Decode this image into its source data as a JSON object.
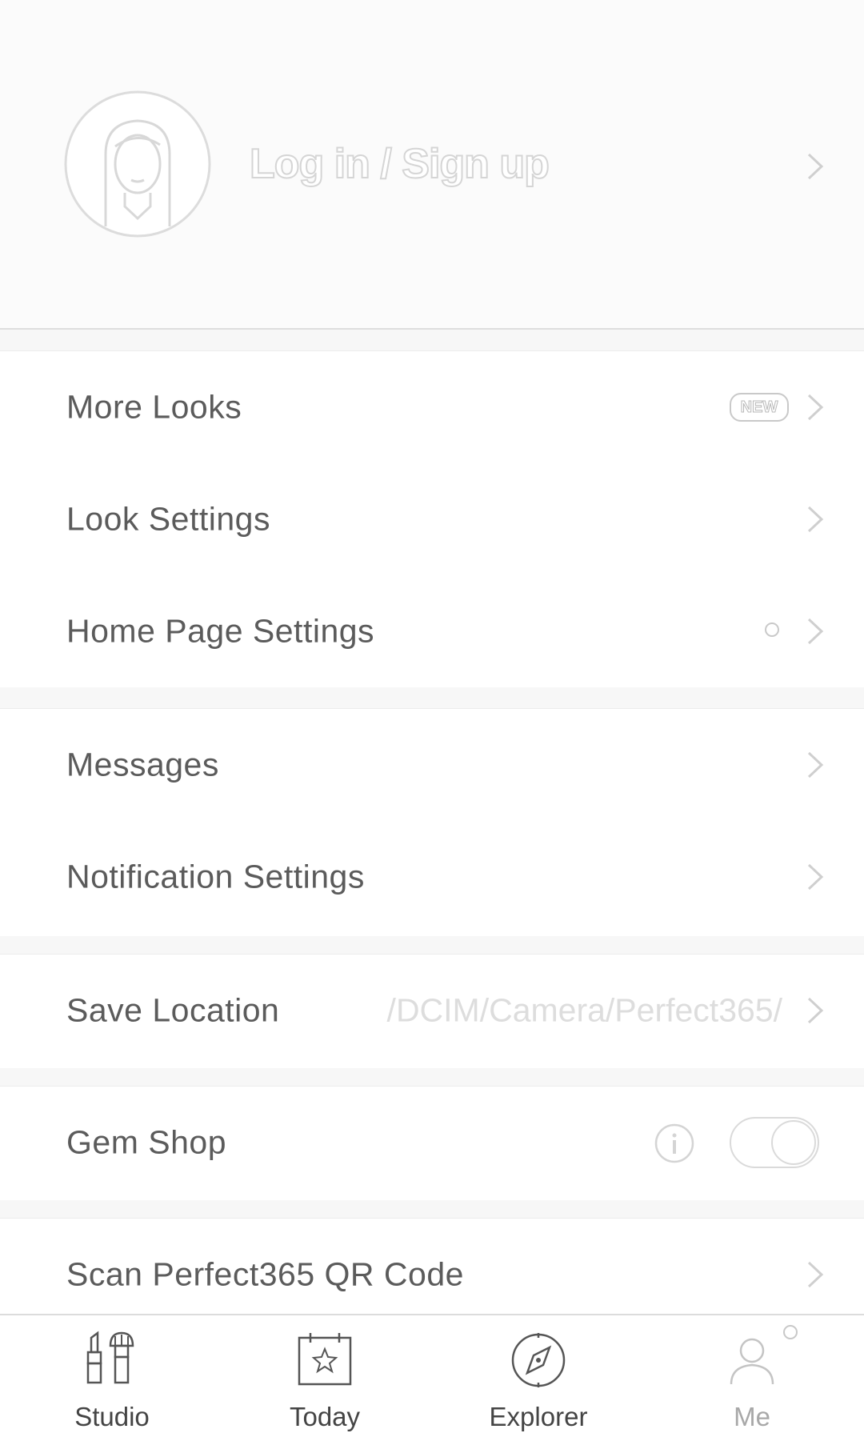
{
  "header": {
    "login_label": "Log in / Sign up",
    "avatar_icon": "female-avatar-icon",
    "chevron_icon": "chevron-right-icon"
  },
  "settings": {
    "more_looks": {
      "label": "More Looks",
      "badge": "NEW"
    },
    "look_settings": {
      "label": "Look Settings"
    },
    "home_page_settings": {
      "label": "Home Page Settings"
    },
    "messages": {
      "label": "Messages"
    },
    "notification_settings": {
      "label": "Notification Settings"
    },
    "save_location": {
      "label": "Save Location",
      "value": "/DCIM/Camera/Perfect365/"
    },
    "gem_shop": {
      "label": "Gem Shop",
      "toggle_on": false,
      "info_icon": "info-icon"
    },
    "scan_qr": {
      "label": "Scan Perfect365 QR Code"
    }
  },
  "tabbar": {
    "tabs": [
      {
        "label": "Studio",
        "icon": "lipstick-brush-icon",
        "active": false
      },
      {
        "label": "Today",
        "icon": "calendar-star-icon",
        "active": false
      },
      {
        "label": "Explorer",
        "icon": "compass-icon",
        "active": false
      },
      {
        "label": "Me",
        "icon": "person-icon",
        "active": true
      }
    ]
  },
  "colors": {
    "text": "#5b5b5b",
    "muted": "#dddddd",
    "divider": "#ececec",
    "header_bg": "#fbfbfb"
  }
}
